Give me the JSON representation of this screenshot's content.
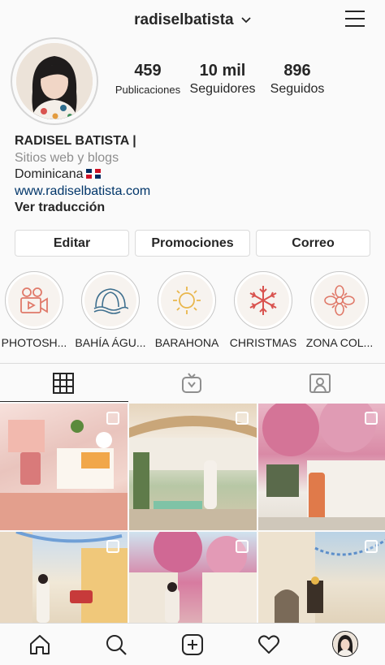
{
  "header": {
    "username": "radiselbatista"
  },
  "stats": [
    {
      "num": "459",
      "label": "Publicaciones"
    },
    {
      "num": "10 mil",
      "label": "Seguidores"
    },
    {
      "num": "896",
      "label": "Seguidos"
    }
  ],
  "bio": {
    "name": "RADISEL BATISTA |",
    "category": "Sitios web y blogs",
    "location": "Dominicana",
    "link": "www.radiselbatista.com",
    "translate": "Ver traducción"
  },
  "buttons": {
    "edit": "Editar",
    "promotions": "Promociones",
    "email": "Correo"
  },
  "highlights": [
    {
      "label": "PHOTOSH..."
    },
    {
      "label": "BAHÍA ÁGU..."
    },
    {
      "label": "BARAHONA"
    },
    {
      "label": "CHRISTMAS"
    },
    {
      "label": "ZONA COL..."
    }
  ],
  "colors": {
    "link": "#003569",
    "muted": "#8e8e8e",
    "border": "#dbdbdb",
    "highlight_icon": "#e07a6a"
  }
}
